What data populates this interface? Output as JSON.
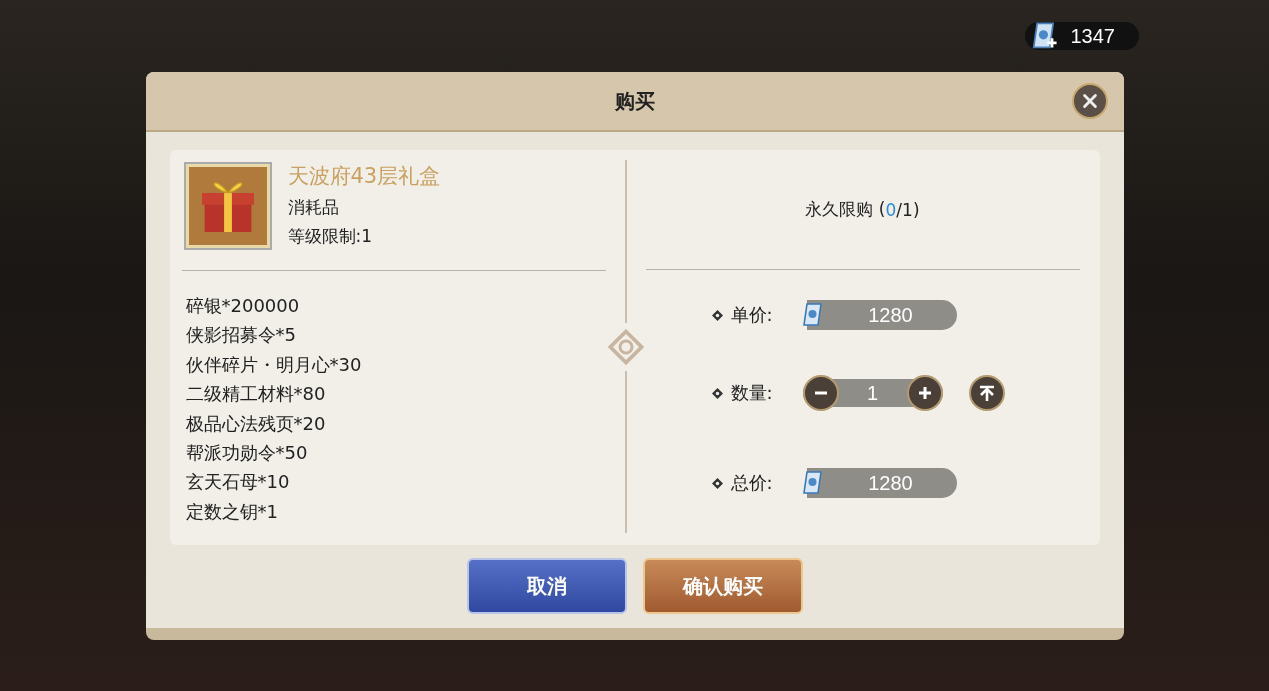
{
  "currency": {
    "amount": "1347"
  },
  "dialog": {
    "title": "购买",
    "item": {
      "name": "天波府43层礼盒",
      "type": "消耗品",
      "level_req": "等级限制:1"
    },
    "contents": [
      "碎银*200000",
      "侠影招募令*5",
      "伙伴碎片・明月心*30",
      "二级精工材料*80",
      "极品心法残页*20",
      "帮派功勋令*50",
      "玄天石母*10",
      "定数之钥*1"
    ],
    "limit": {
      "prefix": "永久限购 (",
      "count": "0",
      "suffix": "/1)"
    },
    "unit_price": {
      "label": "单价:",
      "value": "1280"
    },
    "quantity": {
      "label": "数量:",
      "value": "1"
    },
    "total_price": {
      "label": "总价:",
      "value": "1280"
    },
    "buttons": [
      {
        "kind": "cancel",
        "label": "取消"
      },
      {
        "kind": "confirm",
        "label": "确认购买"
      }
    ]
  }
}
